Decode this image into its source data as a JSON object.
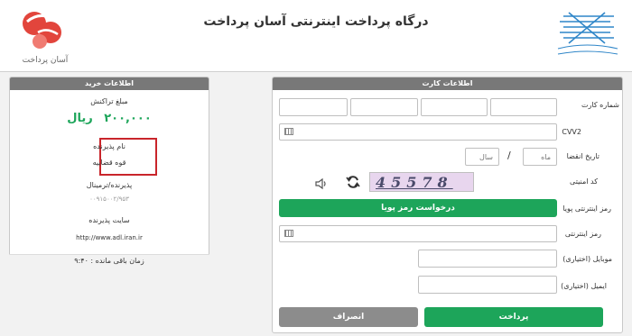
{
  "header": {
    "title": "درگاه پرداخت اینترنتی آسان پرداخت",
    "brand_text": "آسان پرداخت"
  },
  "card_panel": {
    "title": "اطلاعات کارت",
    "card_number_label": "شماره کارت",
    "cvv2_label": "CVV2",
    "expiry_label": "تاریخ انقضا",
    "month_placeholder": "ماه",
    "year_placeholder": "سال",
    "separator": "/",
    "captcha_label": "کد امنیتی",
    "captcha_text": "45578",
    "dynamic_pin_label": "رمز اینترنتی پویا",
    "dynamic_pin_button": "درخواست رمز پویا",
    "pin_label": "رمز اینترنتی",
    "mobile_label": "موبایل (اختیاری)",
    "email_label": "ایمیل (اختیاری)",
    "pay_button": "پرداخت",
    "cancel_button": "انصراف"
  },
  "buy_panel": {
    "title": "اطلاعات خرید",
    "amount_label": "مبلغ تراکنش",
    "amount_value": "۲۰۰,۰۰۰",
    "amount_unit": "ریال",
    "acceptor_label": "نام پذیرنده",
    "acceptor_value": "قوه قضاییه",
    "terminal_label": "پذیرنده/ترمینال",
    "terminal_value": "۰۰۹۱۵۰۰۲/۹۵۳",
    "site_label": "سایت پذیرنده",
    "site_value": "http://www.adl.iran.ir",
    "timer_text": "زمان باقی مانده : ۹:۴۰"
  },
  "colors": {
    "accent_green": "#1da55a",
    "panel_header": "#787878",
    "highlight_red": "#c9252b",
    "logo_red": "#e2453c"
  },
  "icons": [
    "keypad-icon",
    "speaker-icon",
    "refresh-icon"
  ]
}
